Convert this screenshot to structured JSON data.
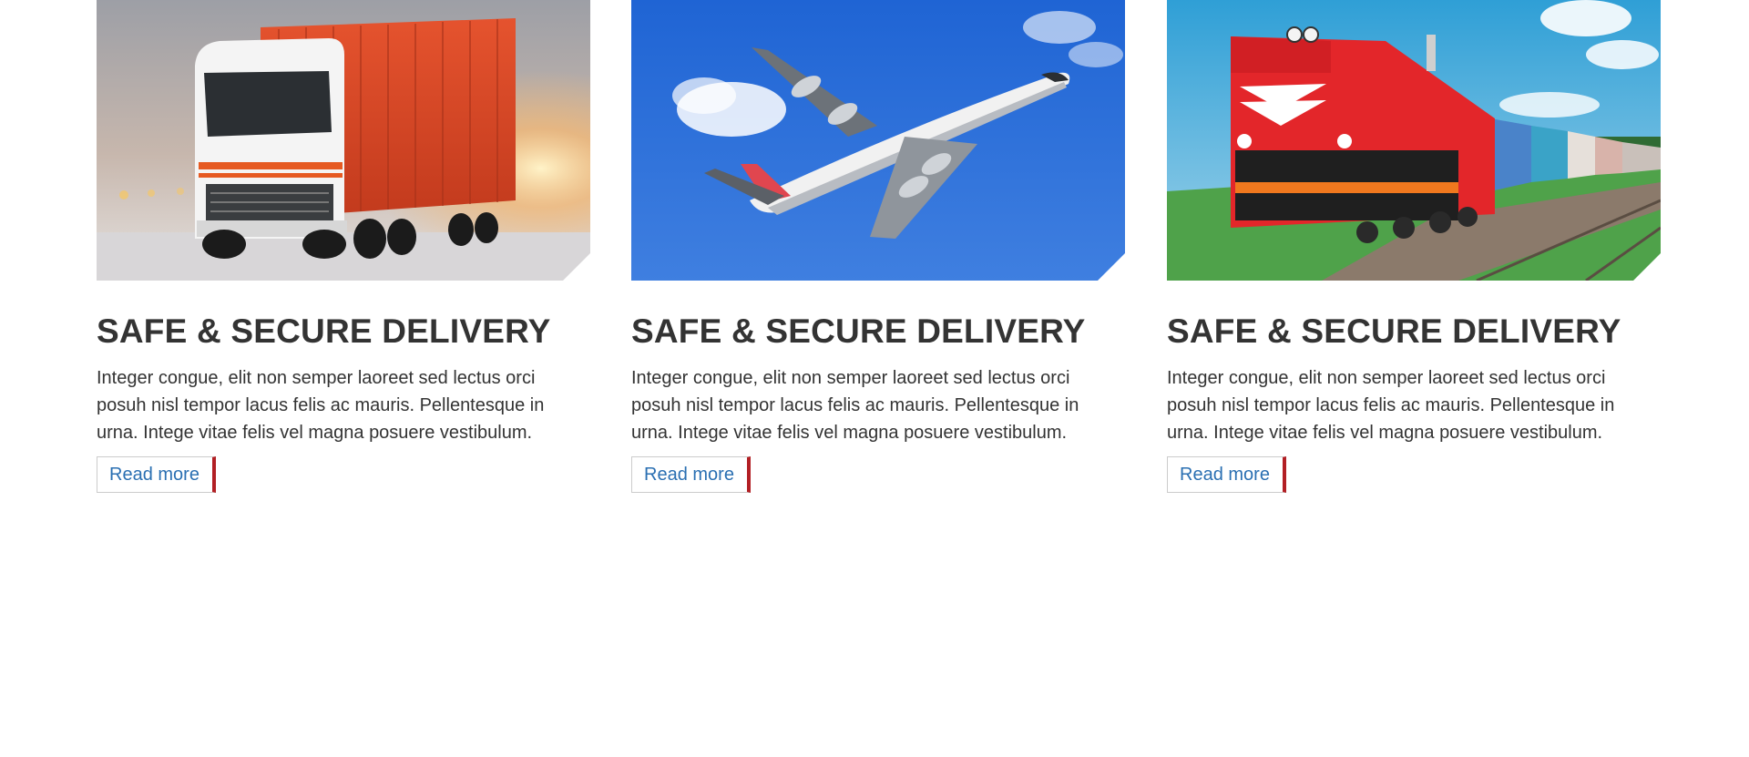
{
  "cards": [
    {
      "image_icon": "truck-image",
      "title": "SAFE & SECURE DELIVERY",
      "text": "Integer congue, elit non semper laoreet sed lectus orci posuh nisl tempor lacus felis ac mauris. Pellentesque in urna. Intege vitae felis vel magna posuere vestibulum.",
      "button_label": "Read more"
    },
    {
      "image_icon": "airplane-image",
      "title": "SAFE & SECURE DELIVERY",
      "text": "Integer congue, elit non semper laoreet sed lectus orci posuh nisl tempor lacus felis ac mauris. Pellentesque in urna. Intege vitae felis vel magna posuere vestibulum.",
      "button_label": "Read more"
    },
    {
      "image_icon": "train-image",
      "title": "SAFE & SECURE DELIVERY",
      "text": "Integer congue, elit non semper laoreet sed lectus orci posuh nisl tempor lacus felis ac mauris. Pellentesque in urna. Intege vitae felis vel magna posuere vestibulum.",
      "button_label": "Read more"
    }
  ],
  "colors": {
    "title": "#333333",
    "body_text": "#333333",
    "link": "#2a6fb2",
    "accent_bar": "#b21f24",
    "button_border": "#cccccc"
  }
}
